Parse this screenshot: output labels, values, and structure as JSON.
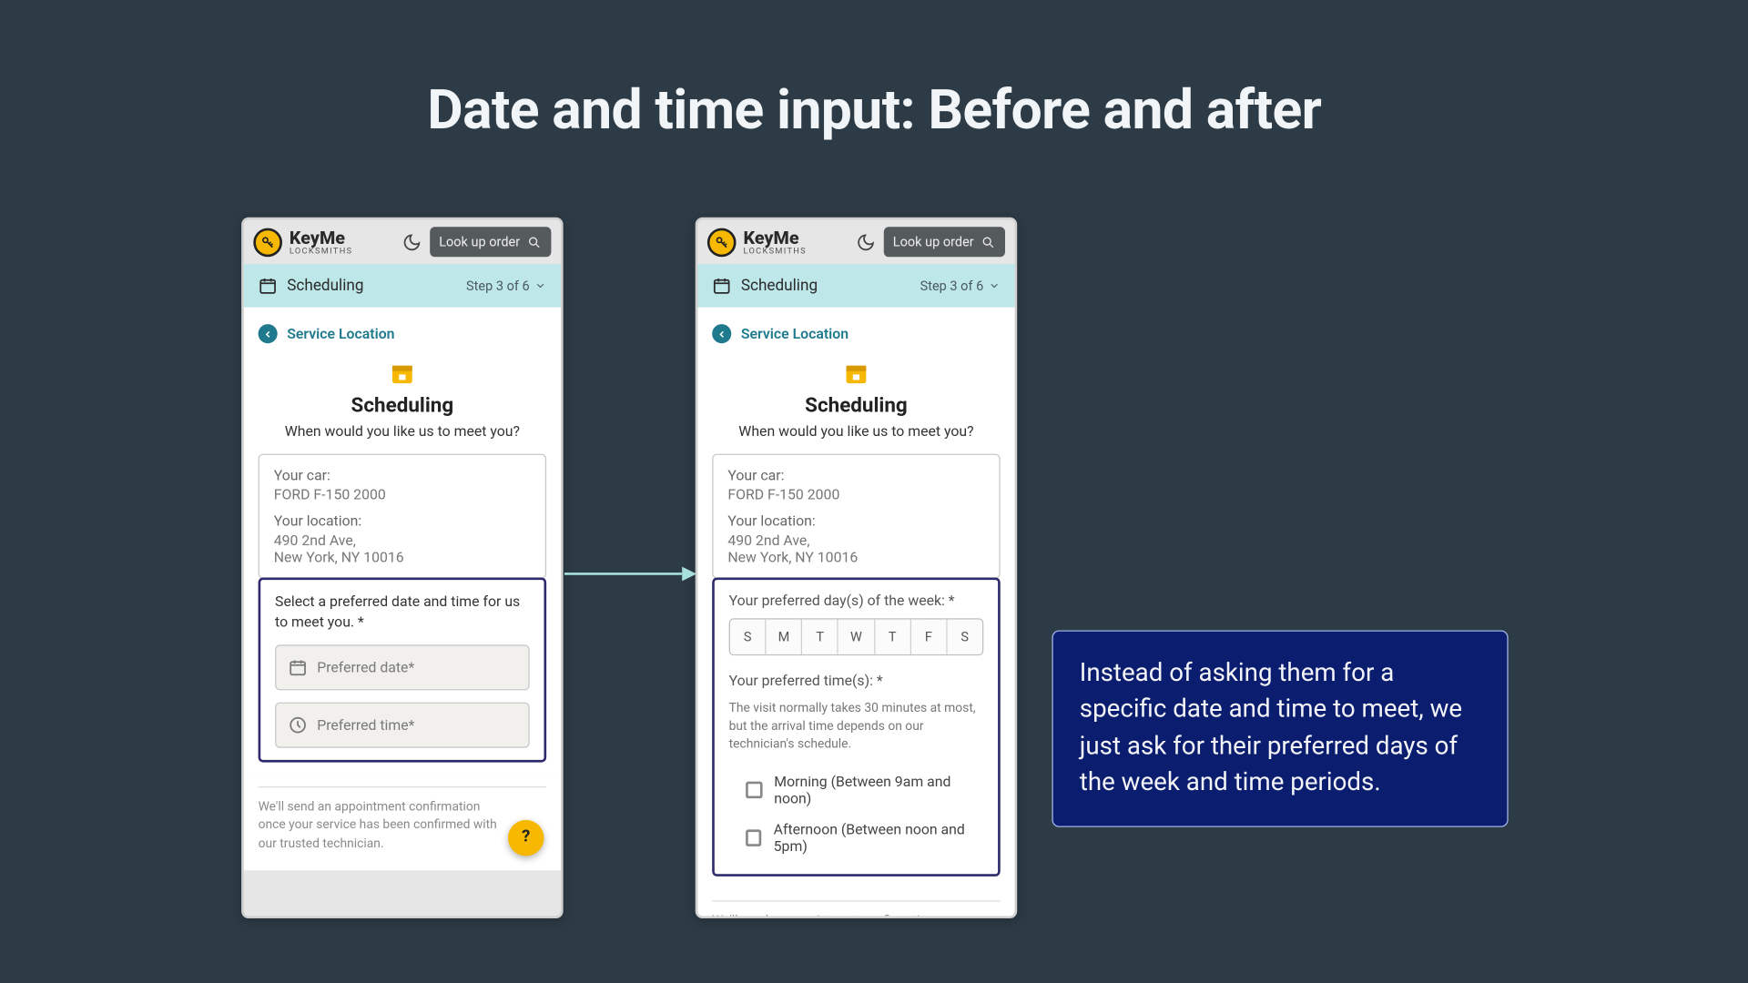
{
  "slide": {
    "title": "Date and time input: Before and after"
  },
  "brand": {
    "name": "KeyMe",
    "sub": "LOCKSMITHS"
  },
  "header": {
    "lookup": "Look up order"
  },
  "stepbar": {
    "label": "Scheduling",
    "step": "Step 3 of 6"
  },
  "nav": {
    "back": "Service Location"
  },
  "sched": {
    "title": "Scheduling",
    "subtitle": "When would you like us to meet you?"
  },
  "info": {
    "car_label": "Your car:",
    "car_value": "FORD F-150 2000",
    "loc_label": "Your location:",
    "loc_line1": "490 2nd Ave,",
    "loc_line2": "New York, NY 10016"
  },
  "before": {
    "prompt": "Select a preferred date and time for us to meet you. *",
    "date_placeholder": "Preferred date*",
    "time_placeholder": "Preferred time*"
  },
  "after": {
    "days_label": "Your preferred day(s) of the week: *",
    "days": [
      "S",
      "M",
      "T",
      "W",
      "T",
      "F",
      "S"
    ],
    "times_label": "Your preferred time(s): *",
    "hint": "The visit normally takes 30 minutes at most, but the arrival time depends on our technician's schedule.",
    "opt_morning": "Morning (Between 9am and noon)",
    "opt_afternoon": "Afternoon (Between noon and 5pm)"
  },
  "foot": {
    "note": "We'll send an appointment confirmation once your service has been confirmed with our trusted technician."
  },
  "callout": {
    "text": "Instead of asking them for a specific date and time to meet, we just ask for their preferred days of the week and time periods."
  },
  "colors": {
    "accent": "#f6b800",
    "step_bg": "#bde7e8",
    "callout_bg": "#0b1d6e"
  }
}
